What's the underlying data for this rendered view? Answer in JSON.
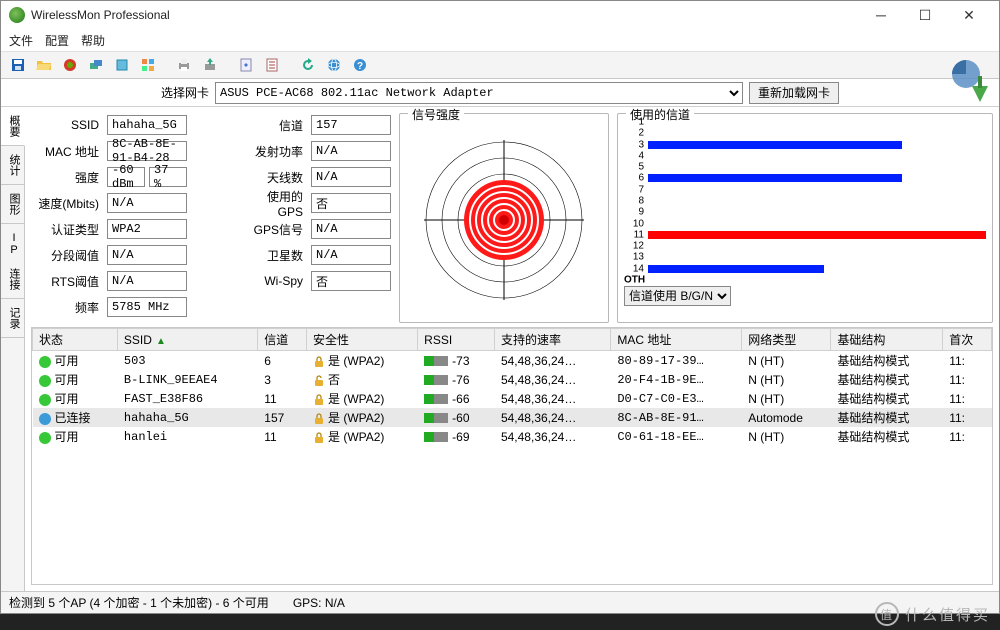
{
  "window": {
    "title": "WirelessMon Professional"
  },
  "menu": {
    "file": "文件",
    "config": "配置",
    "help": "帮助"
  },
  "adapter": {
    "label": "选择网卡",
    "selected": "ASUS PCE-AC68 802.11ac Network Adapter",
    "reload": "重新加载网卡"
  },
  "sidetabs": {
    "t1": "概要",
    "t2": "统计",
    "t3": "图形",
    "t4": "IP 连接",
    "t5": "记录"
  },
  "fields": {
    "ssid_l": "SSID",
    "ssid_v": "hahaha_5G",
    "mac_l": "MAC 地址",
    "mac_v": "8C-AB-8E-91-B4-28",
    "strength_l": "强度",
    "strength_v1": "-60 dBm",
    "strength_v2": "37 %",
    "speed_l": "速度(Mbits)",
    "speed_v": "N/A",
    "auth_l": "认证类型",
    "auth_v": "WPA2",
    "frag_l": "分段阈值",
    "frag_v": "N/A",
    "rts_l": "RTS阈值",
    "rts_v": "N/A",
    "freq_l": "频率",
    "freq_v": "5785 MHz",
    "chan_l": "信道",
    "chan_v": "157",
    "txpow_l": "发射功率",
    "txpow_v": "N/A",
    "ant_l": "天线数",
    "ant_v": "N/A",
    "gps_l": "使用的GPS",
    "gps_v": "否",
    "gpssig_l": "GPS信号",
    "gpssig_v": "N/A",
    "sat_l": "卫星数",
    "sat_v": "N/A",
    "wispy_l": "Wi-Spy",
    "wispy_v": "否"
  },
  "groups": {
    "signal": "信号强度",
    "channels": "使用的信道"
  },
  "channel_select": "信道使用 B/G/N",
  "chart_data": {
    "type": "bar",
    "orientation": "horizontal",
    "title": "使用的信道",
    "xlabel": "",
    "ylabel": "信道",
    "ylim": [
      1,
      14
    ],
    "oth_label": "OTH",
    "channels_shown": [
      1,
      2,
      3,
      4,
      5,
      6,
      7,
      8,
      9,
      10,
      11,
      12,
      13,
      14
    ],
    "bars": [
      {
        "channel": 3,
        "value": 75,
        "color": "#0020ff"
      },
      {
        "channel": 6,
        "value": 75,
        "color": "#0020ff"
      },
      {
        "channel": 11,
        "value": 100,
        "color": "#ff0000"
      },
      {
        "channel": 14,
        "value": 52,
        "color": "#0020ff"
      }
    ]
  },
  "table": {
    "headers": {
      "status": "状态",
      "ssid": "SSID",
      "chan": "信道",
      "sec": "安全性",
      "rssi": "RSSI",
      "rates": "支持的速率",
      "mac": "MAC 地址",
      "net": "网络类型",
      "infra": "基础结构",
      "first": "首次"
    },
    "rows": [
      {
        "status": "可用",
        "dot": "#37c837",
        "ssid": "503",
        "chan": "6",
        "sec": "是 (WPA2)",
        "locked": true,
        "rssi": "-73",
        "rates": "54,48,36,24…",
        "mac": "80-89-17-39…",
        "net": "N (HT)",
        "infra": "基础结构模式",
        "first": "11:"
      },
      {
        "status": "可用",
        "dot": "#37c837",
        "ssid": "B-LINK_9EEAE4",
        "chan": "3",
        "sec": "否",
        "locked": false,
        "rssi": "-76",
        "rates": "54,48,36,24…",
        "mac": "20-F4-1B-9E…",
        "net": "N (HT)",
        "infra": "基础结构模式",
        "first": "11:"
      },
      {
        "status": "可用",
        "dot": "#37c837",
        "ssid": "FAST_E38F86",
        "chan": "11",
        "sec": "是 (WPA2)",
        "locked": true,
        "rssi": "-66",
        "rates": "54,48,36,24…",
        "mac": "D0-C7-C0-E3…",
        "net": "N (HT)",
        "infra": "基础结构模式",
        "first": "11:"
      },
      {
        "status": "已连接",
        "dot": "#3a9bd8",
        "ssid": "hahaha_5G",
        "chan": "157",
        "sec": "是 (WPA2)",
        "locked": true,
        "rssi": "-60",
        "rates": "54,48,36,24…",
        "mac": "8C-AB-8E-91…",
        "net": "Automode",
        "infra": "基础结构模式",
        "first": "11:",
        "selected": true
      },
      {
        "status": "可用",
        "dot": "#37c837",
        "ssid": "hanlei",
        "chan": "11",
        "sec": "是 (WPA2)",
        "locked": true,
        "rssi": "-69",
        "rates": "54,48,36,24…",
        "mac": "C0-61-18-EE…",
        "net": "N (HT)",
        "infra": "基础结构模式",
        "first": "11:"
      }
    ]
  },
  "statusbar": {
    "left": "检测到 5 个AP (4 个加密 - 1 个未加密) - 6 个可用",
    "gps": "GPS: N/A"
  },
  "watermark": "什么值得买"
}
